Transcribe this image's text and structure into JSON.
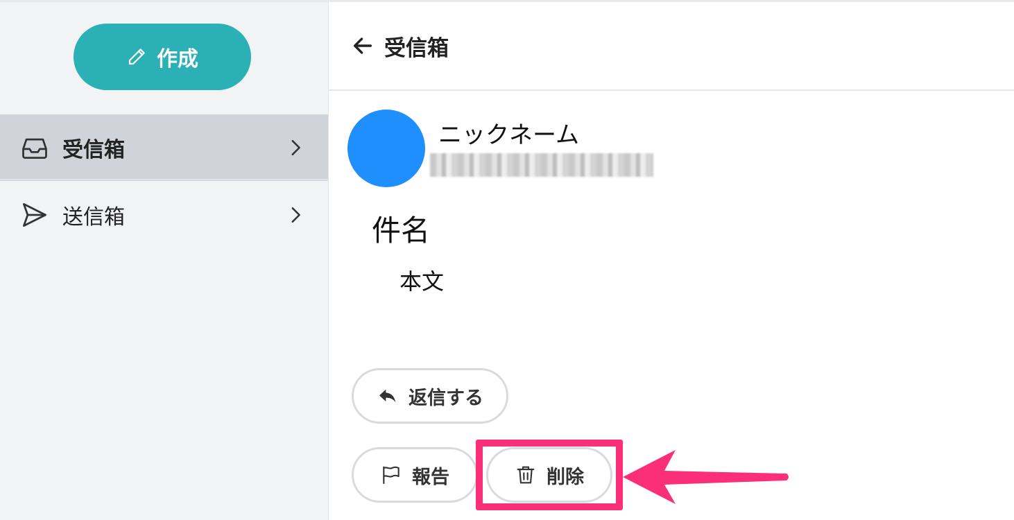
{
  "sidebar": {
    "compose_label": "作成",
    "items": [
      {
        "label": "受信箱",
        "icon": "inbox-icon",
        "active": true
      },
      {
        "label": "送信箱",
        "icon": "send-icon",
        "active": false
      }
    ]
  },
  "header": {
    "back_icon": "arrow-left-icon",
    "title": "受信箱"
  },
  "message": {
    "sender_name": "ニックネーム",
    "sender_email": "",
    "subject": "件名",
    "body": "本文"
  },
  "actions": {
    "reply_label": "返信する",
    "report_label": "報告",
    "delete_label": "削除"
  },
  "colors": {
    "accent": "#2ab0b5",
    "avatar": "#1e8ffd",
    "highlight": "#fb2f77",
    "sidebar_bg": "#f2f3f5",
    "sidebar_active": "#d0d3da"
  }
}
